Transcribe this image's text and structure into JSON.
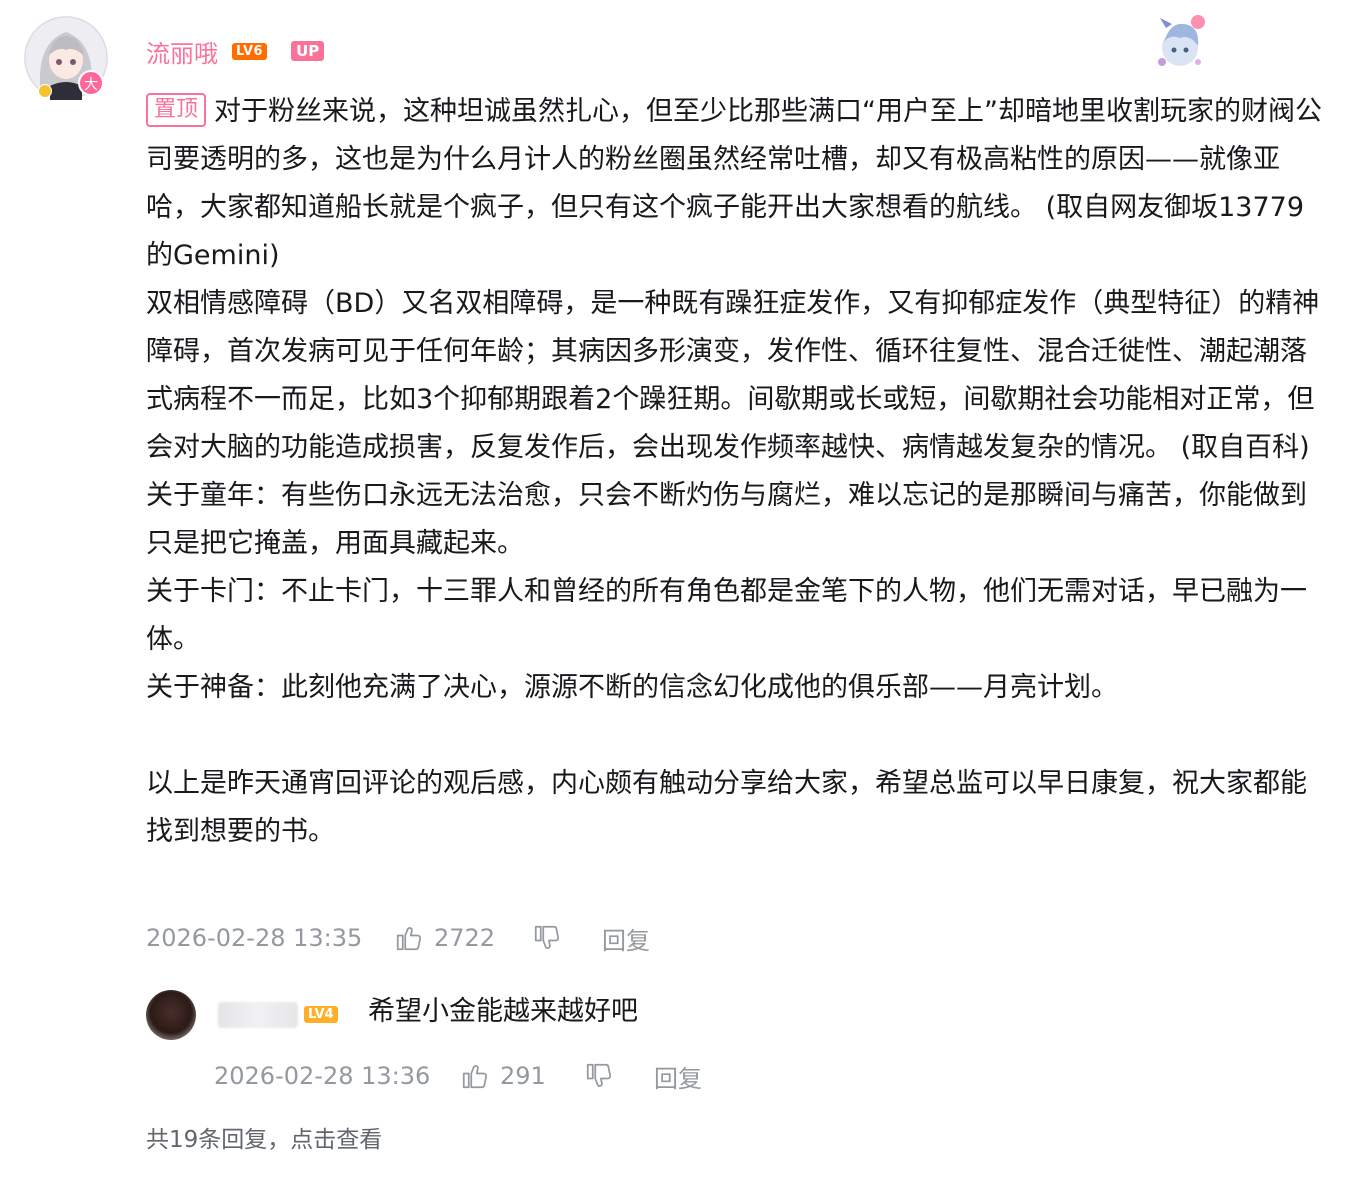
{
  "comment": {
    "username": "流丽哦",
    "level": "LV6",
    "up_badge": "UP",
    "pinned_label": "置顶",
    "paragraphs": [
      "对于粉丝来说，这种坦诚虽然扎心，但至少比那些满口“用户至上”却暗地里收割玩家的财阀公司要透明的多，这也是为什么月计人的粉丝圈虽然经常吐槽，却又有极高粘性的原因——就像亚哈，大家都知道船长就是个疯子，但只有这个疯子能开出大家想看的航线。  (取自网友御坂13779的Gemini)",
      "双相情感障碍（BD）又名双相障碍，是一种既有躁狂症发作，又有抑郁症发作（典型特征）的精神障碍，首次发病可见于任何年龄；其病因多形演变，发作性、循环往复性、混合迁徙性、潮起潮落式病程不一而足，比如3个抑郁期跟着2个躁狂期。间歇期或长或短，间歇期社会功能相对正常，但会对大脑的功能造成损害，反复发作后，会出现发作频率越快、病情越发复杂的情况。  (取自百科)",
      "关于童年：有些伤口永远无法治愈，只会不断灼伤与腐烂，难以忘记的是那瞬间与痛苦，你能做到只是把它掩盖，用面具藏起来。",
      "关于卡门：不止卡门，十三罪人和曾经的所有角色都是金笔下的人物，他们无需对话，早已融为一体。",
      "关于神备：此刻他充满了决心，源源不断的信念幻化成他的俱乐部——月亮计划。",
      "以上是昨天通宵回评论的观后感，内心颇有触动分享给大家，希望总监可以早日康复，祝大家都能找到想要的书。"
    ],
    "timestamp": "2026-02-28 13:35",
    "likes": "2722",
    "reply_label": "回复"
  },
  "reply": {
    "level": "LV4",
    "text": "希望小金能越来越好吧",
    "timestamp": "2026-02-28 13:36",
    "likes": "291",
    "reply_label": "回复"
  },
  "more_replies": "共19条回复，点击查看",
  "avatar_badge": "大",
  "colors": {
    "pink": "#fb7299",
    "meta_gray": "#9499a0",
    "level6": "#ff6c00",
    "level4": "#ffb027"
  },
  "icons": [
    "thumb-up-icon",
    "thumb-down-icon"
  ]
}
